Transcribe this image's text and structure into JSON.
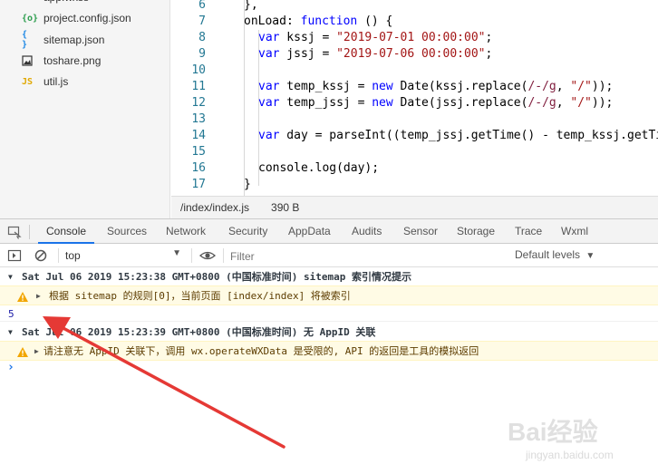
{
  "file_tree": {
    "items": [
      {
        "icon": "{o}",
        "icon_color": "#2e9e4f",
        "label": "project.config.json"
      },
      {
        "icon": "{ }",
        "icon_color": "#1e88e5",
        "label": "sitemap.json"
      },
      {
        "icon": "img",
        "icon_color": "#333333",
        "label": "toshare.png"
      },
      {
        "icon": "JS",
        "icon_color": "#e0a800",
        "label": "util.js"
      }
    ]
  },
  "editor": {
    "lines": [
      {
        "num": "6",
        "text": "},"
      },
      {
        "num": "7",
        "text": "onLoad: function () {"
      },
      {
        "num": "8",
        "text": "var kssj = \"2019-07-01 00:00:00\";"
      },
      {
        "num": "9",
        "text": "var jssj = \"2019-07-06 00:00:00\";"
      },
      {
        "num": "10",
        "text": ""
      },
      {
        "num": "11",
        "text": "var temp_kssj = new Date(kssj.replace(/-/g, \"/\"));"
      },
      {
        "num": "12",
        "text": "var temp_jssj = new Date(jssj.replace(/-/g, \"/\"));"
      },
      {
        "num": "13",
        "text": ""
      },
      {
        "num": "14",
        "text": "var day = parseInt((temp_jssj.getTime() - temp_kssj.getTir"
      },
      {
        "num": "15",
        "text": ""
      },
      {
        "num": "16",
        "text": "console.log(day);"
      },
      {
        "num": "17",
        "text": "}"
      }
    ]
  },
  "statusbar": {
    "path": "/index/index.js",
    "size": "390 B"
  },
  "devtools": {
    "tabs": [
      "Console",
      "Sources",
      "Network",
      "Security",
      "AppData",
      "Audits",
      "Sensor",
      "Storage",
      "Trace",
      "Wxml"
    ],
    "active_tab": "Console"
  },
  "console_toolbar": {
    "context": "top",
    "filter_placeholder": "Filter",
    "levels": "Default levels"
  },
  "console": {
    "group1": "Sat Jul 06 2019 15:23:38 GMT+0800 (中国标准时间) sitemap 索引情况提示",
    "warn1": "根据 sitemap 的规则[0]，当前页面 [index/index] 将被索引",
    "log_value": "5",
    "group2": "Sat Jul 06 2019 15:23:39 GMT+0800 (中国标准时间) 无 AppID 关联",
    "warn2": "请注意无 AppID 关联下，调用 wx.operateWXData 是受限的, API 的返回是工具的模拟返回",
    "prompt": "›"
  },
  "watermark": {
    "brand": "Bai经验",
    "url": "jingyan.baidu.com"
  },
  "colors": {
    "arrow": "#e53935",
    "accent": "#1a73e8",
    "warning_bg": "#fffbe5"
  }
}
